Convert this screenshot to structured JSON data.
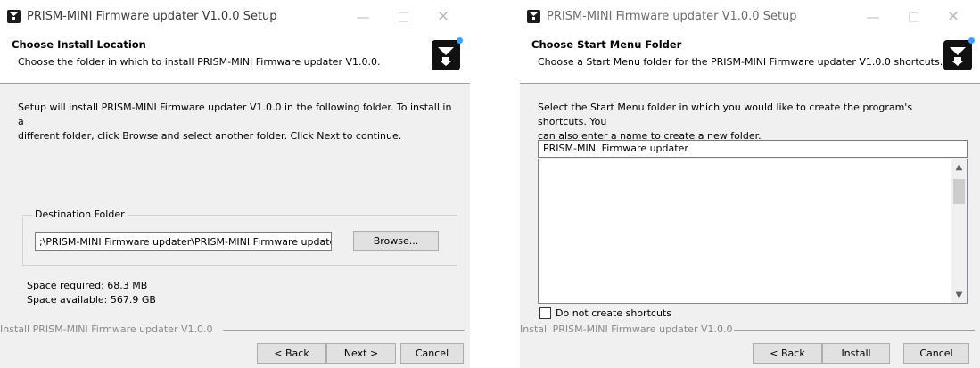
{
  "left_window": {
    "title": "PRISM-MINI Firmware updater V1.0.0 Setup",
    "header_title": "Choose Install Location",
    "header_subtitle": "Choose the folder in which to install PRISM-MINI Firmware updater V1.0.0.",
    "body_line1": "Setup will install PRISM-MINI Firmware updater V1.0.0 in the following folder. To install in a",
    "body_line2": "different folder, click Browse and select another folder. Click Next to continue.",
    "destination_label": "Destination Folder",
    "destination_value": ";\\PRISM-MINI Firmware updater\\PRISM-MINI Firmware updater",
    "browse_label": "Browse...",
    "space_required": "Space required: 68.3 MB",
    "space_available": "Space available: 567.9 GB",
    "branding": "Install PRISM-MINI Firmware updater V1.0.0",
    "back_label": "< Back",
    "next_label": "Next >",
    "cancel_label": "Cancel"
  },
  "right_window": {
    "title": "PRISM-MINI Firmware updater V1.0.0 Setup",
    "header_title": "Choose Start Menu Folder",
    "header_subtitle": "Choose a Start Menu folder for the PRISM-MINI Firmware updater V1.0.0 shortcuts.",
    "body_line1": "Select the Start Menu folder in which you would like to create the program's shortcuts. You",
    "body_line2": "can also enter a name to create a new folder.",
    "folder_value": "PRISM-MINI Firmware updater",
    "no_shortcuts_label": "Do not create shortcuts",
    "branding": "Install PRISM-MINI Firmware updater V1.0.0",
    "back_label": "< Back",
    "install_label": "Install",
    "cancel_label": "Cancel"
  },
  "icons": {
    "minimize": "—",
    "close": "✕",
    "scroll_up": "▲",
    "scroll_down": "▼"
  },
  "colors": {
    "accent": "#3aa0ff"
  }
}
